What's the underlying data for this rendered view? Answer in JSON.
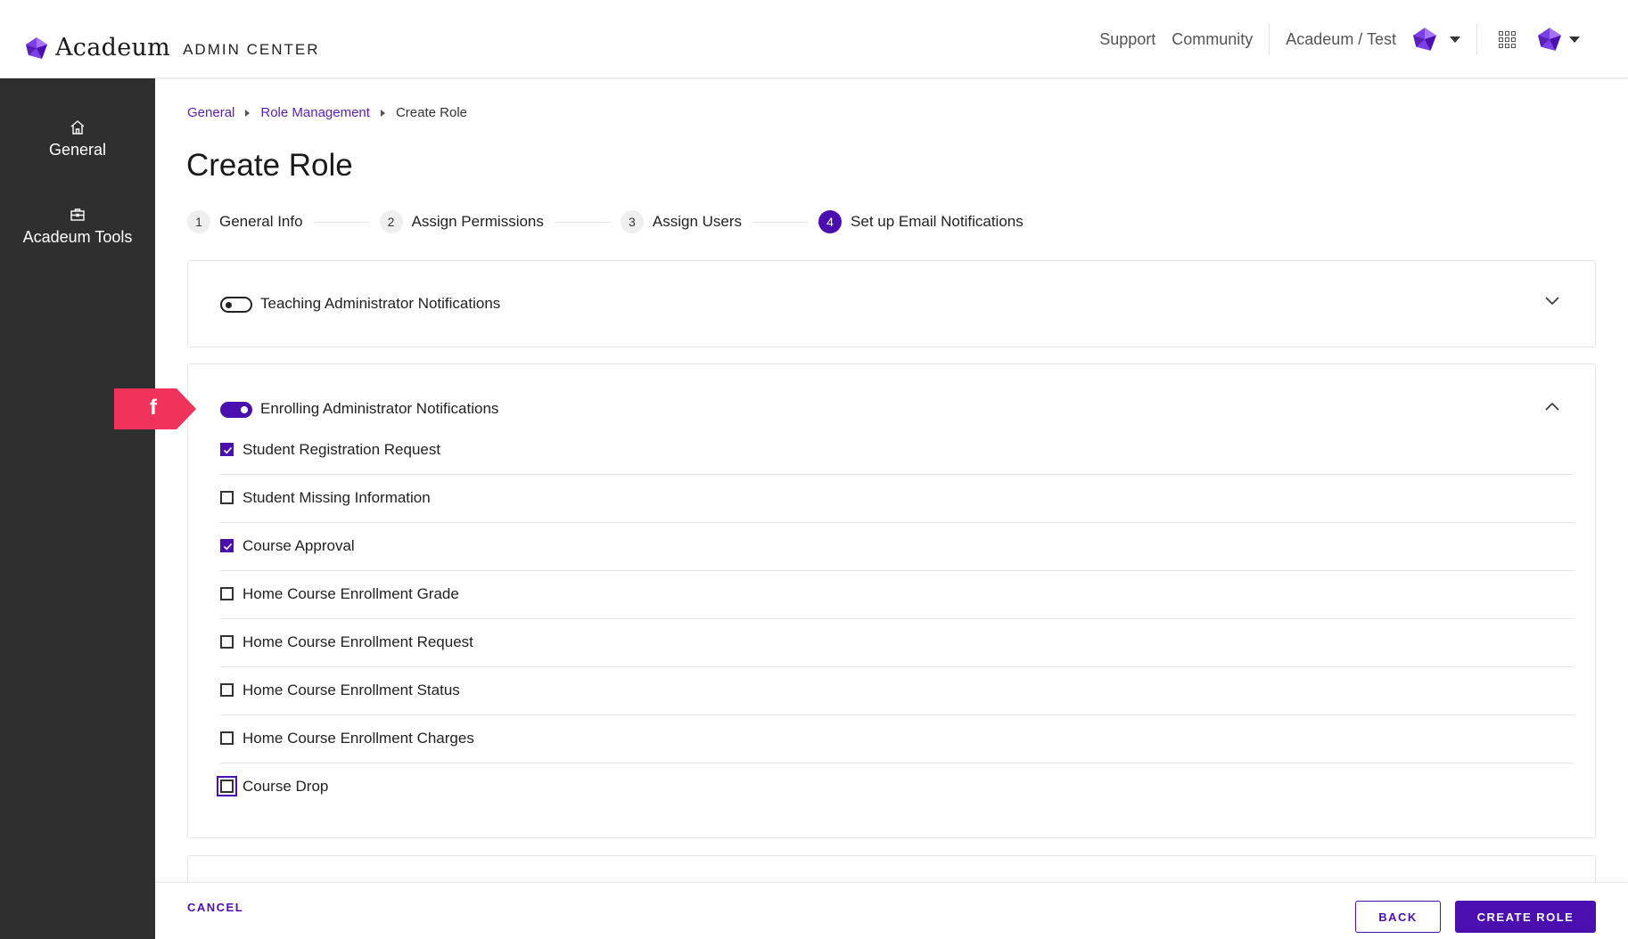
{
  "header": {
    "brand": "Acadeum",
    "subtitle": "ADMIN CENTER",
    "links": {
      "support": "Support",
      "community": "Community"
    },
    "institution": "Acadeum / Test"
  },
  "sidebar": {
    "items": [
      {
        "label": "General",
        "icon": "home-icon"
      },
      {
        "label": "Acadeum Tools",
        "icon": "toolbox-icon"
      }
    ]
  },
  "breadcrumb": {
    "items": [
      "General",
      "Role Management"
    ],
    "current": "Create Role"
  },
  "page": {
    "title": "Create Role"
  },
  "stepper": {
    "steps": [
      {
        "num": "1",
        "label": "General Info"
      },
      {
        "num": "2",
        "label": "Assign Permissions"
      },
      {
        "num": "3",
        "label": "Assign Users"
      },
      {
        "num": "4",
        "label": "Set up Email Notifications",
        "active": true
      }
    ]
  },
  "sections": [
    {
      "title": "Teaching Administrator Notifications",
      "enabled": false,
      "expanded": false
    },
    {
      "title": "Enrolling Administrator Notifications",
      "enabled": true,
      "expanded": true,
      "options": [
        {
          "label": "Student Registration Request",
          "checked": true
        },
        {
          "label": "Student Missing Information",
          "checked": false
        },
        {
          "label": "Course Approval",
          "checked": true
        },
        {
          "label": "Home Course Enrollment Grade",
          "checked": false
        },
        {
          "label": "Home Course Enrollment Request",
          "checked": false
        },
        {
          "label": "Home Course Enrollment Status",
          "checked": false
        },
        {
          "label": "Home Course Enrollment Charges",
          "checked": false
        },
        {
          "label": "Course Drop",
          "checked": false,
          "focused": true
        }
      ]
    }
  ],
  "callout": {
    "label": "f",
    "color": "#f0335a"
  },
  "footer": {
    "cancel": "CANCEL",
    "back": "BACK",
    "create": "CREATE ROLE"
  },
  "colors": {
    "accent": "#4b0fb0",
    "sidebar_bg": "#2f2f2f",
    "link": "#5a1fb4"
  }
}
